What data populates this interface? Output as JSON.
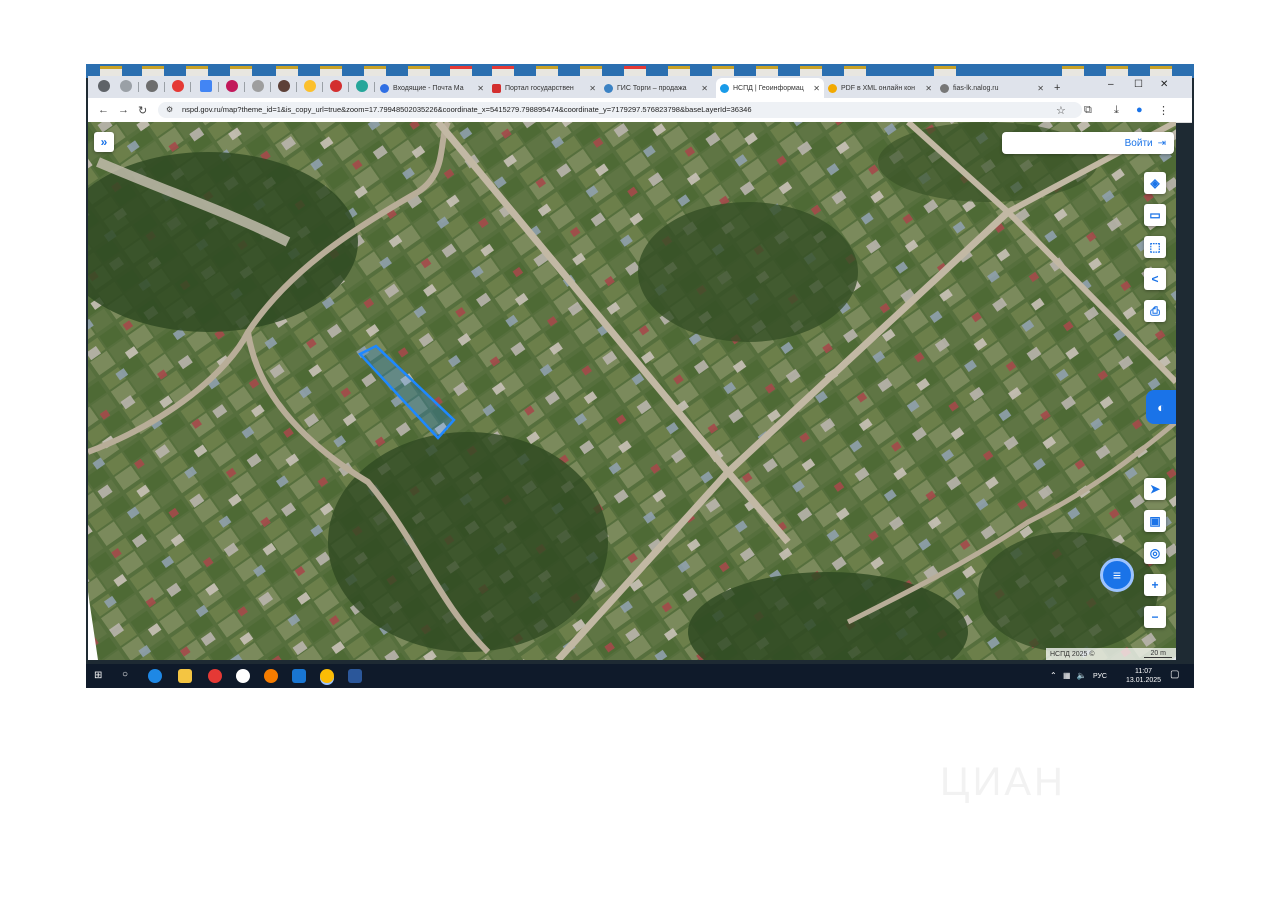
{
  "browser": {
    "tabs": [
      {
        "label": "Входящие - Почта Ма",
        "favicon_color": "#2f6fe4"
      },
      {
        "label": "Портал государствен",
        "favicon_color": "#d32f2f"
      },
      {
        "label": "ГИС Торги – продажа",
        "favicon_color": "#3b82c4"
      },
      {
        "label": "НСПД | Геоинформац",
        "favicon_color": "#1a9be8",
        "active": true
      },
      {
        "label": "PDF в XML онлайн кон",
        "favicon_color": "#f2a900"
      },
      {
        "label": "fias-lk.nalog.ru",
        "favicon_color": "#777777"
      }
    ],
    "new_tab": "+",
    "url": "nspd.gov.ru/map?theme_id=1&is_copy_url=true&zoom=17.79948502035226&coordinate_x=5415279.798895474&coordinate_y=7179297.576823798&baseLayerId=36346"
  },
  "map": {
    "login_label": "Войти",
    "controls": [
      "layers-icon",
      "ruler-icon",
      "select-area-icon",
      "share-icon",
      "print-icon",
      "locate-icon",
      "minimap-icon",
      "geolocation-icon",
      "zoom-in",
      "zoom-out"
    ],
    "zoom_in": "+",
    "zoom_out": "−",
    "copyright": "НСПД 2025 ©",
    "scale": "20 m",
    "parcel_color": "#1e88ff"
  },
  "taskbar": {
    "language": "РУС",
    "time": "11:07",
    "date": "13.01.2025"
  },
  "watermark": "ЦИАН"
}
